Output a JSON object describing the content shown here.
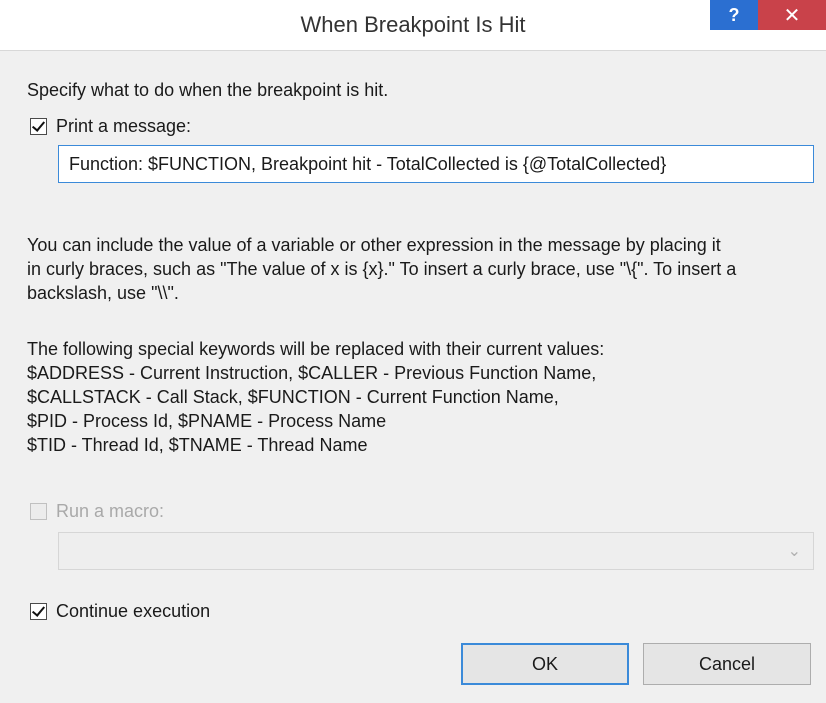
{
  "window": {
    "title": "When Breakpoint Is Hit",
    "help_label": "?",
    "close_label": "✕"
  },
  "intro": "Specify what to do when the breakpoint is hit.",
  "print_message": {
    "label": "Print a message:",
    "checked": true,
    "value": "Function: $FUNCTION, Breakpoint hit - TotalCollected is {@TotalCollected}"
  },
  "help_text": {
    "line1": "You can include the value of a variable or other expression in the message by placing it",
    "line2": "in curly braces, such as \"The value of x is {x}.\" To insert a curly brace, use \"\\{\". To insert a",
    "line3": "backslash, use \"\\\\\"."
  },
  "keywords": {
    "line1": "The following special keywords will be replaced with their current values:",
    "line2": "$ADDRESS - Current Instruction, $CALLER - Previous Function Name,",
    "line3": "$CALLSTACK - Call Stack, $FUNCTION - Current Function Name,",
    "line4": "$PID - Process Id, $PNAME - Process Name",
    "line5": "$TID - Thread Id, $TNAME - Thread Name"
  },
  "run_macro": {
    "label": "Run a macro:",
    "checked": false,
    "disabled": true,
    "selected": ""
  },
  "continue_execution": {
    "label": "Continue execution",
    "checked": true
  },
  "buttons": {
    "ok": "OK",
    "cancel": "Cancel"
  }
}
